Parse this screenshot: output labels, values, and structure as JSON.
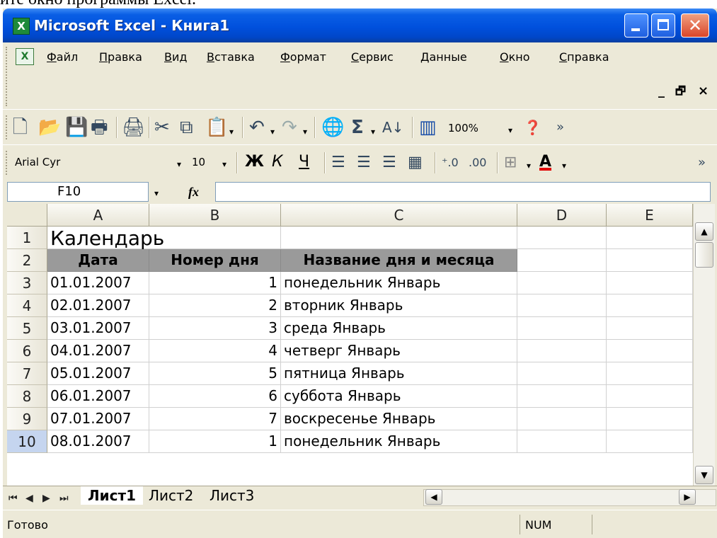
{
  "caption": "ите окно программы Excel.",
  "window": {
    "title": "Microsoft Excel - Книга1",
    "icon_letter": "X"
  },
  "window_controls": {
    "close_glyph": "✕"
  },
  "menu": {
    "items": [
      "Файл",
      "Правка",
      "Вид",
      "Вставка",
      "Формат",
      "Сервис",
      "Данные",
      "Окно",
      "Справка"
    ],
    "doc_minimize": "_",
    "doc_restore": "🗗",
    "doc_close": "×"
  },
  "standard_toolbar": {
    "zoom": "100%",
    "more": "»"
  },
  "formatting_toolbar": {
    "font": "Arial Cyr",
    "size": "10",
    "bold": "Ж",
    "italic": "К",
    "underline": "Ч",
    "more": "»",
    "font_color": "#e00000"
  },
  "formula_bar": {
    "name_box": "F10",
    "fx": "fx",
    "formula": ""
  },
  "sheet": {
    "columns": [
      "A",
      "B",
      "C",
      "D",
      "E"
    ],
    "rows": [
      "1",
      "2",
      "3",
      "4",
      "5",
      "6",
      "7",
      "8",
      "9",
      "10"
    ],
    "active_row": "10",
    "title": "Календарь",
    "headers": [
      "Дата",
      "Номер дня",
      "Название дня и месяца"
    ],
    "data": [
      [
        "01.01.2007",
        "1",
        "понедельник Январь"
      ],
      [
        "02.01.2007",
        "2",
        "вторник Январь"
      ],
      [
        "03.01.2007",
        "3",
        "среда Январь"
      ],
      [
        "04.01.2007",
        "4",
        "четверг Январь"
      ],
      [
        "05.01.2007",
        "5",
        "пятница Январь"
      ],
      [
        "06.01.2007",
        "6",
        "суббота Январь"
      ],
      [
        "07.01.2007",
        "7",
        "воскресенье Январь"
      ],
      [
        "08.01.2007",
        "1",
        "понедельник Январь"
      ]
    ]
  },
  "tabs": [
    "Лист1",
    "Лист2",
    "Лист3"
  ],
  "active_tab": "Лист1",
  "status": {
    "text": "Готово",
    "num": "NUM"
  }
}
